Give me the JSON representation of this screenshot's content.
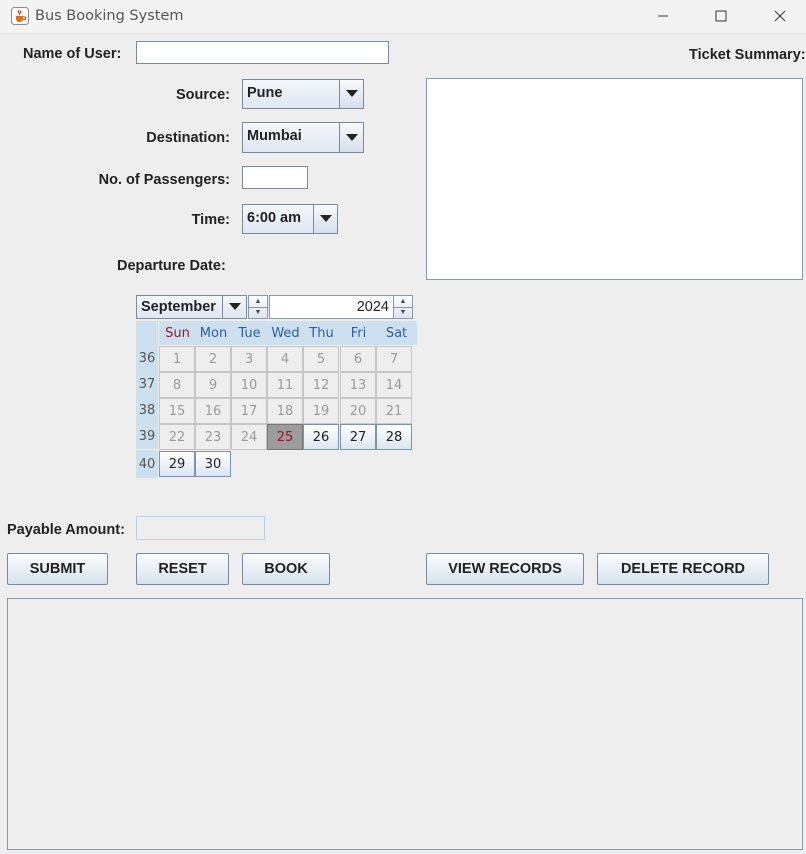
{
  "window": {
    "title": "Bus Booking System"
  },
  "form": {
    "name_label": "Name of User:",
    "name_value": "",
    "source_label": "Source:",
    "source_value": "Pune",
    "destination_label": "Destination:",
    "destination_value": "Mumbai",
    "passengers_label": "No. of Passengers:",
    "passengers_value": "",
    "time_label": "Time:",
    "time_value": "6:00 am",
    "departure_label": "Departure Date:",
    "payable_label": "Payable Amount:",
    "payable_value": ""
  },
  "summary": {
    "label": "Ticket Summary:",
    "text": ""
  },
  "calendar": {
    "month": "September",
    "year": "2024",
    "weekday_headers": [
      "Sun",
      "Mon",
      "Tue",
      "Wed",
      "Thu",
      "Fri",
      "Sat"
    ],
    "weeks": [
      {
        "num": "36",
        "days": [
          "1",
          "2",
          "3",
          "4",
          "5",
          "6",
          "7"
        ]
      },
      {
        "num": "37",
        "days": [
          "8",
          "9",
          "10",
          "11",
          "12",
          "13",
          "14"
        ]
      },
      {
        "num": "38",
        "days": [
          "15",
          "16",
          "17",
          "18",
          "19",
          "20",
          "21"
        ]
      },
      {
        "num": "39",
        "days": [
          "22",
          "23",
          "24",
          "25",
          "26",
          "27",
          "28"
        ]
      },
      {
        "num": "40",
        "days": [
          "29",
          "30"
        ]
      }
    ],
    "selected_day": "25",
    "first_selectable_day": 25,
    "colors": {
      "sunday": "#a0102a",
      "weekday": "#2c5fa0",
      "header_bg": "#cde0ef"
    }
  },
  "buttons": {
    "submit": "SUBMIT",
    "reset": "RESET",
    "book": "BOOK",
    "view_records": "VIEW RECORDS",
    "delete_record": "DELETE RECORD"
  },
  "icons": {
    "app": "java-cup-icon",
    "minimize": "minimize-icon",
    "maximize": "maximize-icon",
    "close": "close-icon",
    "dropdown": "triangle-down-icon"
  }
}
